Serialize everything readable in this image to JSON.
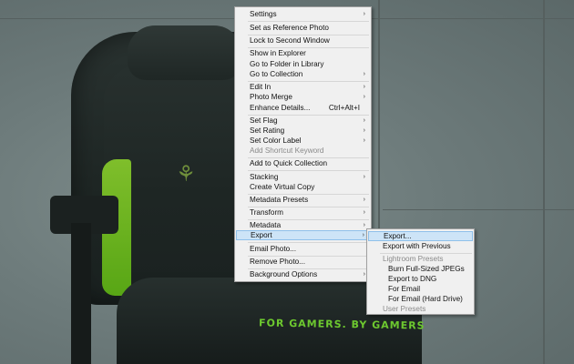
{
  "background": {
    "seat_text": "FOR GAMERS. BY GAMERS"
  },
  "main_menu": {
    "items": [
      {
        "label": "Settings",
        "submenu": true
      },
      {
        "label": "Set as Reference Photo"
      },
      {
        "label": "Lock to Second Window"
      },
      {
        "label": "Show in Explorer"
      },
      {
        "label": "Go to Folder in Library"
      },
      {
        "label": "Go to Collection",
        "submenu": true
      },
      {
        "label": "Edit In",
        "submenu": true
      },
      {
        "label": "Photo Merge",
        "submenu": true
      },
      {
        "label": "Enhance Details...",
        "shortcut": "Ctrl+Alt+I"
      },
      {
        "label": "Set Flag",
        "submenu": true
      },
      {
        "label": "Set Rating",
        "submenu": true
      },
      {
        "label": "Set Color Label",
        "submenu": true
      },
      {
        "label": "Add Shortcut Keyword",
        "disabled": true
      },
      {
        "label": "Add to Quick Collection"
      },
      {
        "label": "Stacking",
        "submenu": true
      },
      {
        "label": "Create Virtual Copy"
      },
      {
        "label": "Metadata Presets",
        "submenu": true
      },
      {
        "label": "Transform",
        "submenu": true
      },
      {
        "label": "Metadata",
        "submenu": true
      },
      {
        "label": "Export",
        "submenu": true,
        "highlighted": true
      },
      {
        "label": "Email Photo..."
      },
      {
        "label": "Remove Photo..."
      },
      {
        "label": "Background Options",
        "submenu": true
      }
    ]
  },
  "export_submenu": {
    "items": [
      {
        "label": "Export...",
        "highlighted": true
      },
      {
        "label": "Export with Previous"
      },
      {
        "label": "Lightroom Presets",
        "disabled": true
      },
      {
        "label": "Burn Full-Sized JPEGs"
      },
      {
        "label": "Export to DNG"
      },
      {
        "label": "For Email"
      },
      {
        "label": "For Email (Hard Drive)"
      },
      {
        "label": "User Presets",
        "disabled": true
      }
    ]
  },
  "colors": {
    "menu_bg": "#f0f0f0",
    "highlight_bg": "#cde4f7",
    "highlight_border": "#8fc0ea",
    "disabled_text": "#8a8a8a",
    "razer_green": "#6dc82f"
  },
  "icons": {
    "submenu_arrow": "chevron-right-icon"
  }
}
